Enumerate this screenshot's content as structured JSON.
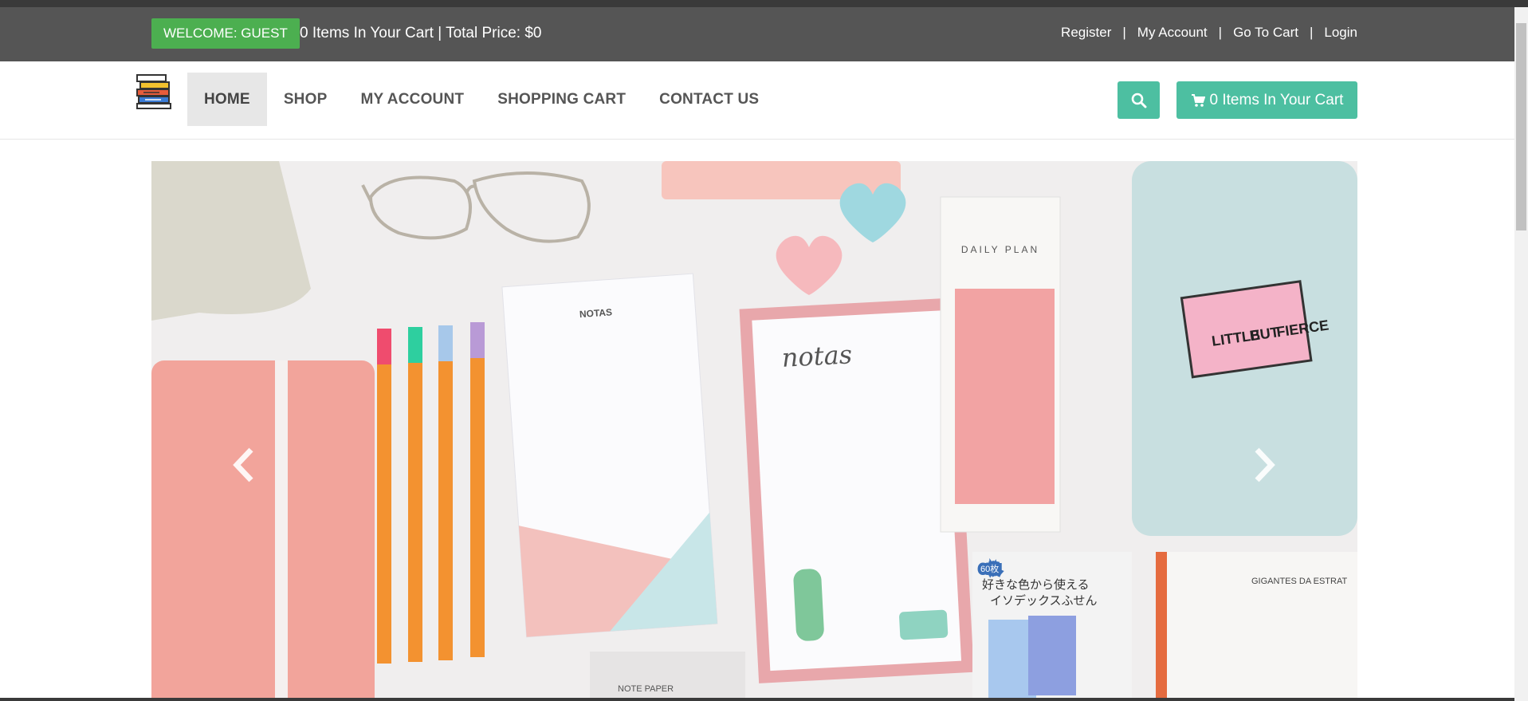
{
  "topbar": {
    "welcome": "WELCOME: GUEST",
    "cart_summary": "0 Items In Your Cart | Total Price: $0",
    "links": {
      "register": "Register",
      "my_account": "My Account",
      "go_to_cart": "Go To Cart",
      "login": "Login"
    },
    "separator": "|"
  },
  "nav": {
    "home": "HOME",
    "shop": "SHOP",
    "my_account": "MY ACCOUNT",
    "shopping_cart": "SHOPPING CART",
    "contact_us": "CONTACT US",
    "active": "HOME"
  },
  "header": {
    "cart_button": "0 Items In Your Cart",
    "search_icon": "search-icon",
    "cart_icon": "shopping-cart-icon"
  },
  "carousel": {
    "image_text": {
      "notepad_1": "NOTAS",
      "notepad_2": "notas",
      "daily_plan": "DAILY PLAN",
      "pouch_1": "LITTLE",
      "pouch_2": "BUT",
      "pouch_3": "FIERCE",
      "book_title": "GIGANTES DA ESTRAT",
      "sticky_jp": "好きな色から使える",
      "sticky_jp_2": "イソデックスふせん",
      "sticky_count": "60枚",
      "bottom_pad": "NOTE PAPER"
    },
    "prev_icon": "chevron-left-icon",
    "next_icon": "chevron-right-icon"
  },
  "colors": {
    "topbar_bg": "#555555",
    "welcome_green": "#4caf50",
    "accent_teal": "#4dbfa1"
  }
}
